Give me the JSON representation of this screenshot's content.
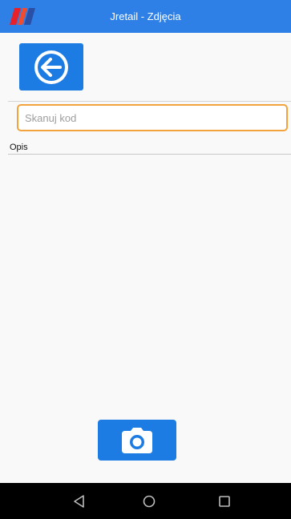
{
  "app_bar": {
    "title": "Jretail - Zdjęcia",
    "logo_icon": "jretail-logo-icon",
    "background_color": "#2f80e6"
  },
  "toolbar": {
    "back_icon": "arrow-left-circle-icon",
    "accent_color": "#1c7ce3"
  },
  "scan": {
    "value": "",
    "placeholder": "Skanuj kod",
    "border_color": "#f2a33c"
  },
  "description": {
    "label": "Opis"
  },
  "footer": {
    "camera_icon": "camera-icon"
  },
  "system_nav": {
    "back_icon": "nav-back-triangle-icon",
    "home_icon": "nav-home-circle-icon",
    "recents_icon": "nav-recents-square-icon"
  }
}
